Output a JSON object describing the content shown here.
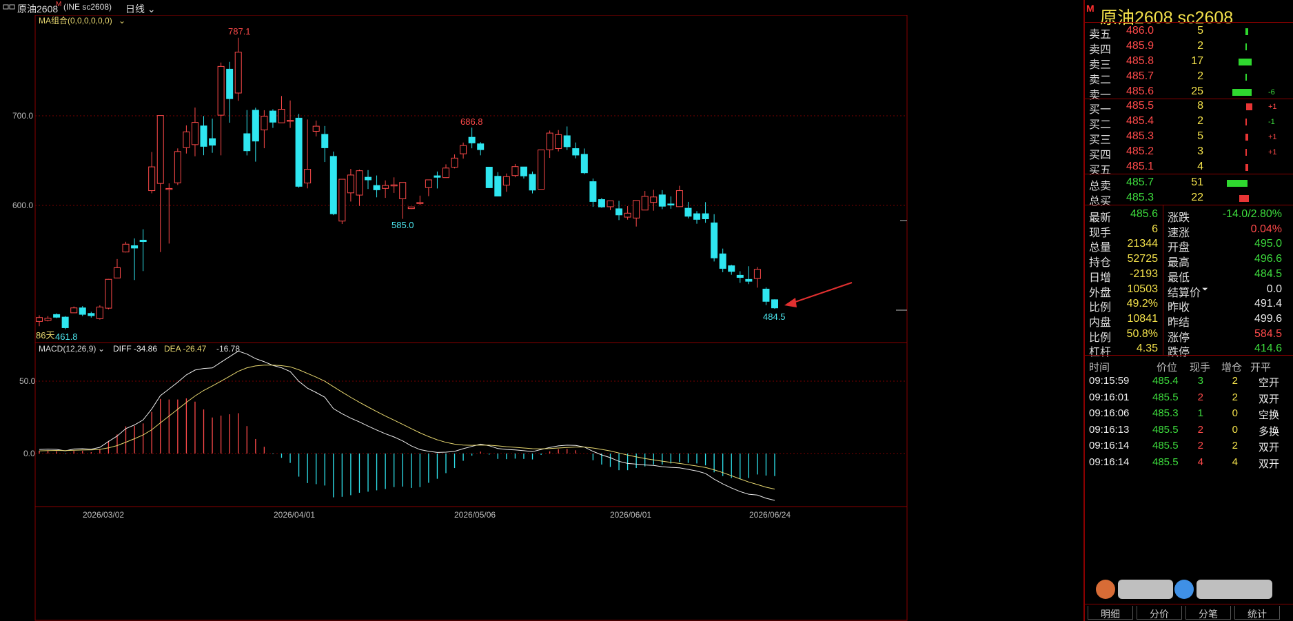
{
  "topbar": {
    "window_icon": "window-icon",
    "symbol_label": "原油2608",
    "symbol_marker": "M",
    "exchange_code": "(INE sc2608)",
    "period_label": "日线"
  },
  "ma_indicator": {
    "label": "MA组合(0,0,0,0,0,0)"
  },
  "macd_indicator": {
    "label": "MACD(12,26,9)",
    "diff": "DIFF -34.86",
    "dea": "DEA -26.47",
    "macd": "-16.78"
  },
  "colors": {
    "up": "#ff4a4a",
    "down": "#2fe6f0",
    "diff_line": "#eeeeee",
    "dea_line": "#e8d870",
    "border": "#8a0000",
    "arrow": "#e23030"
  },
  "annotations": {
    "high": "787.1",
    "peak2": "686.8",
    "low_mid": "585.0",
    "low_start": "461.8",
    "last_low": "484.5",
    "days": "86天"
  },
  "axis": {
    "price_ticks": [
      "700.0",
      "600.0"
    ],
    "macd_ticks": [
      "50.0",
      "0.0"
    ],
    "dates": [
      "2026/03/02",
      "2026/04/01",
      "2026/05/06",
      "2026/06/01",
      "2026/06/24"
    ]
  },
  "chart_data": {
    "type": "candlestick",
    "ylim": [
      450,
      800
    ],
    "candles": [
      [
        470.5,
        474.8,
        465.2,
        477.3
      ],
      [
        471.7,
        474.1,
        470.5,
        476.5
      ],
      [
        478.2,
        475.2,
        474.1,
        479.5
      ],
      [
        475.3,
        463.5,
        461.8,
        476.4
      ],
      [
        480.1,
        485.6,
        480.1,
        487.2
      ],
      [
        485.6,
        478.4,
        476.4,
        487.6
      ],
      [
        479.4,
        477.0,
        474.8,
        481.2
      ],
      [
        473.6,
        486.6,
        472.5,
        488.5
      ],
      [
        485.3,
        517.5,
        484.1,
        517.9
      ],
      [
        519.0,
        530.5,
        518.9,
        540.1
      ],
      [
        548.0,
        556.7,
        547.5,
        559.4
      ],
      [
        555.0,
        552.4,
        516.7,
        563.2
      ],
      [
        561.2,
        559.6,
        526.7,
        573.4
      ],
      [
        616.5,
        643.0,
        613.5,
        659.6
      ],
      [
        624.5,
        700.3,
        547.9,
        700.3
      ],
      [
        618.4,
        618.9,
        557.4,
        624.6
      ],
      [
        625.2,
        660.1,
        622.8,
        663.6
      ],
      [
        664.5,
        682.1,
        657.9,
        689.3
      ],
      [
        667.8,
        692.6,
        654.8,
        709.2
      ],
      [
        688.7,
        665.9,
        656.0,
        699.7
      ],
      [
        674.5,
        667.2,
        658.7,
        696.8
      ],
      [
        700.7,
        755.1,
        655.9,
        759.4
      ],
      [
        752.0,
        719.1,
        692.3,
        760.2
      ],
      [
        725.4,
        771.0,
        716.7,
        787.1
      ],
      [
        680.0,
        661.0,
        655.8,
        706.4
      ],
      [
        706.2,
        671.8,
        648.8,
        709.0
      ],
      [
        684.2,
        699.5,
        663.8,
        706.2
      ],
      [
        705.3,
        692.9,
        686.5,
        707.3
      ],
      [
        692.2,
        707.3,
        702.0,
        722.1
      ],
      [
        694.6,
        695.0,
        686.4,
        717.1
      ],
      [
        697.4,
        621.3,
        619.7,
        702.1
      ],
      [
        625.0,
        640.3,
        619.0,
        695.9
      ],
      [
        682.7,
        688.4,
        677.0,
        694.7
      ],
      [
        679.3,
        664.3,
        648.4,
        688.6
      ],
      [
        654.7,
        590.6,
        589.1,
        660.1
      ],
      [
        582.5,
        629.2,
        579.2,
        629.2
      ],
      [
        614.0,
        633.9,
        604.3,
        640.7
      ],
      [
        611.5,
        638.7,
        599.4,
        639.9
      ],
      [
        631.4,
        628.5,
        618.3,
        639.4
      ],
      [
        622.2,
        617.4,
        609.0,
        633.4
      ],
      [
        619.0,
        622.2,
        608.4,
        627.9
      ],
      [
        622.7,
        622.9,
        613.9,
        631.3
      ],
      [
        607.4,
        625.6,
        585.0,
        625.6
      ],
      [
        596.4,
        598.3,
        596.0,
        597.8
      ],
      [
        603.2,
        603.2,
        600.4,
        610.9
      ],
      [
        619.9,
        628.5,
        610.3,
        621.9
      ],
      [
        633.0,
        631.4,
        618.9,
        637.8
      ],
      [
        631.0,
        641.7,
        636.7,
        645.8
      ],
      [
        642.6,
        652.8,
        641.3,
        656.9
      ],
      [
        657.6,
        666.8,
        652.2,
        670.1
      ],
      [
        676.0,
        669.7,
        663.7,
        686.8
      ],
      [
        668.7,
        662.2,
        655.9,
        670.6
      ],
      [
        642.7,
        619.7,
        619.4,
        642.9
      ],
      [
        632.5,
        610.4,
        610.1,
        637.1
      ],
      [
        622.6,
        632.1,
        615.2,
        635.6
      ],
      [
        633.3,
        643.3,
        631.4,
        646.2
      ],
      [
        642.9,
        632.9,
        630.0,
        642.9
      ],
      [
        634.6,
        617.1,
        613.4,
        637.8
      ],
      [
        618.0,
        661.9,
        617.9,
        662.0
      ],
      [
        662.0,
        680.7,
        653.0,
        683.5
      ],
      [
        663.5,
        679.0,
        660.3,
        684.1
      ],
      [
        677.7,
        665.5,
        661.8,
        688.1
      ],
      [
        663.4,
        656.2,
        652.5,
        670.2
      ],
      [
        657.0,
        636.4,
        634.9,
        663.5
      ],
      [
        626.5,
        604.3,
        598.4,
        630.0
      ],
      [
        606.5,
        598.3,
        597.3,
        608.3
      ],
      [
        598.5,
        605.1,
        594.7,
        601.4
      ],
      [
        596.2,
        589.4,
        583.6,
        605.1
      ],
      [
        586.9,
        591.3,
        584.1,
        599.2
      ],
      [
        585.9,
        605.5,
        576.4,
        605.5
      ],
      [
        594.8,
        610.1,
        594.7,
        616.1
      ],
      [
        603.3,
        609.4,
        594.1,
        617.4
      ],
      [
        611.7,
        599.1,
        595.8,
        617.0
      ],
      [
        601.6,
        600.4,
        596.3,
        610.0
      ],
      [
        598.6,
        616.5,
        603.2,
        621.9
      ],
      [
        596.8,
        587.9,
        585.5,
        603.9
      ],
      [
        590.7,
        584.4,
        579.5,
        593.6
      ],
      [
        590.7,
        585.0,
        580.6,
        603.6
      ],
      [
        580.5,
        541.4,
        537.4,
        590.2
      ],
      [
        545.9,
        529.7,
        525.4,
        551.8
      ],
      [
        532.6,
        526.3,
        522.6,
        533.7
      ],
      [
        522.0,
        519.6,
        513.6,
        526.5
      ],
      [
        517.4,
        515.3,
        512.1,
        532.1
      ],
      [
        518.4,
        528.6,
        508.2,
        531.2
      ],
      [
        506.6,
        492.9,
        488.7,
        508.5
      ],
      [
        494.7,
        485.6,
        484.5,
        495.2
      ]
    ],
    "diff": [
      3.0,
      3.3,
      3.1,
      2.0,
      3.4,
      3.6,
      3.2,
      4.6,
      8.9,
      13.0,
      18.5,
      21.3,
      25.0,
      33.2,
      43.1,
      48.0,
      53.0,
      58.5,
      62.1,
      63.3,
      63.7,
      67.9,
      72.1,
      76.2,
      74.0,
      70.6,
      68.3,
      65.6,
      63.8,
      61.0,
      53.7,
      48.6,
      45.4,
      41.9,
      33.4,
      29.6,
      26.3,
      23.5,
      20.4,
      17.5,
      14.7,
      12.3,
      9.4,
      5.7,
      2.9,
      1.7,
      0.8,
      1.0,
      1.6,
      3.6,
      5.3,
      7.0,
      5.8,
      3.7,
      3.0,
      2.7,
      2.1,
      1.4,
      3.0,
      4.5,
      5.7,
      6.2,
      6.0,
      4.8,
      1.6,
      -1.0,
      -3.1,
      -5.8,
      -7.4,
      -7.9,
      -8.5,
      -8.8,
      -9.8,
      -10.3,
      -10.6,
      -11.8,
      -13.0,
      -14.8,
      -19.1,
      -22.6,
      -25.6,
      -28.3,
      -30.3,
      -30.9,
      -33.3,
      -34.86
    ],
    "dea": [
      2.0,
      2.2,
      2.3,
      2.2,
      2.4,
      2.6,
      2.7,
      3.1,
      4.2,
      5.9,
      8.4,
      11.0,
      13.8,
      17.7,
      22.8,
      27.9,
      32.9,
      38.0,
      42.8,
      46.9,
      50.3,
      53.8,
      57.5,
      61.2,
      63.8,
      65.2,
      65.8,
      65.8,
      65.4,
      64.5,
      62.3,
      59.6,
      56.8,
      53.8,
      49.7,
      45.7,
      41.8,
      38.1,
      34.6,
      31.2,
      27.9,
      24.8,
      21.7,
      18.5,
      15.4,
      12.6,
      10.2,
      8.3,
      7.0,
      6.3,
      6.1,
      6.3,
      6.2,
      5.7,
      5.1,
      4.6,
      4.1,
      3.6,
      3.5,
      3.7,
      4.1,
      4.5,
      4.8,
      4.8,
      4.1,
      3.1,
      1.9,
      0.4,
      -1.2,
      -2.5,
      -3.7,
      -4.7,
      -5.7,
      -6.6,
      -7.4,
      -8.3,
      -9.3,
      -10.4,
      -12.1,
      -14.2,
      -16.5,
      -18.9,
      -21.2,
      -23.1,
      -25.1,
      -26.47
    ],
    "ylabel_macd": "MACD"
  },
  "orderbook": {
    "title": "原油2608  sc2608",
    "marker": "M",
    "asks": [
      {
        "label": "卖五",
        "price": "486.0",
        "qty": "5",
        "bar": 0.2,
        "delta": ""
      },
      {
        "label": "卖四",
        "price": "485.9",
        "qty": "2",
        "bar": 0.08,
        "delta": ""
      },
      {
        "label": "卖三",
        "price": "485.8",
        "qty": "17",
        "bar": 0.62,
        "delta": ""
      },
      {
        "label": "卖二",
        "price": "485.7",
        "qty": "2",
        "bar": 0.08,
        "delta": ""
      },
      {
        "label": "卖一",
        "price": "485.6",
        "qty": "25",
        "bar": 0.92,
        "delta": "-6"
      }
    ],
    "bids": [
      {
        "label": "买一",
        "price": "485.5",
        "qty": "8",
        "bar": 0.3,
        "delta": "+1"
      },
      {
        "label": "买二",
        "price": "485.4",
        "qty": "2",
        "bar": 0.08,
        "delta": "-1"
      },
      {
        "label": "买三",
        "price": "485.3",
        "qty": "5",
        "bar": 0.2,
        "delta": "+1"
      },
      {
        "label": "买四",
        "price": "485.2",
        "qty": "3",
        "bar": 0.12,
        "delta": "+1"
      },
      {
        "label": "买五",
        "price": "485.1",
        "qty": "4",
        "bar": 0.15,
        "delta": ""
      }
    ],
    "total_sell": {
      "label": "总卖",
      "price": "485.7",
      "qty": "51",
      "bar": 1.0
    },
    "total_buy": {
      "label": "总买",
      "price": "485.3",
      "qty": "22",
      "bar": 0.45
    }
  },
  "stats": [
    {
      "l1": "最新",
      "v1": "485.6",
      "c1": "green",
      "l2": "涨跌",
      "v2": "-14.0/2.80%",
      "c2": "green"
    },
    {
      "l1": "现手",
      "v1": "6",
      "c1": "yellow",
      "l2": "速涨",
      "v2": "0.04%",
      "c2": "red"
    },
    {
      "l1": "总量",
      "v1": "21344",
      "c1": "yellow",
      "l2": "开盘",
      "v2": "495.0",
      "c2": "green"
    },
    {
      "l1": "持仓",
      "v1": "52725",
      "c1": "yellow",
      "l2": "最高",
      "v2": "496.6",
      "c2": "green"
    },
    {
      "l1": "日增",
      "v1": "-2193",
      "c1": "yellow",
      "l2": "最低",
      "v2": "484.5",
      "c2": "green"
    },
    {
      "l1": "外盘",
      "v1": "10503",
      "c1": "yellow",
      "l2": "结算价",
      "v2": "0.0",
      "c2": "white"
    },
    {
      "l1": "比例",
      "v1": "49.2%",
      "c1": "yellow",
      "l2": "昨收",
      "v2": "491.4",
      "c2": "white"
    },
    {
      "l1": "内盘",
      "v1": "10841",
      "c1": "yellow",
      "l2": "昨结",
      "v2": "499.6",
      "c2": "white"
    },
    {
      "l1": "比例",
      "v1": "50.8%",
      "c1": "yellow",
      "l2": "涨停",
      "v2": "584.5",
      "c2": "red"
    },
    {
      "l1": "杠杆",
      "v1": "4.35",
      "c1": "yellow",
      "l2": "跌停",
      "v2": "414.6",
      "c2": "green"
    }
  ],
  "ticks": {
    "headers": [
      "时间",
      "价位",
      "现手",
      "增仓",
      "开平"
    ],
    "rows": [
      {
        "time": "09:15:59",
        "price": "485.4",
        "qty": "3",
        "qc": "green",
        "add": "2",
        "type": "空开"
      },
      {
        "time": "09:16:01",
        "price": "485.5",
        "qty": "2",
        "qc": "red",
        "add": "2",
        "type": "双开"
      },
      {
        "time": "09:16:06",
        "price": "485.3",
        "qty": "1",
        "qc": "green",
        "add": "0",
        "type": "空换"
      },
      {
        "time": "09:16:13",
        "price": "485.5",
        "qty": "2",
        "qc": "red",
        "add": "0",
        "type": "多换"
      },
      {
        "time": "09:16:14",
        "price": "485.5",
        "qty": "2",
        "qc": "red",
        "add": "2",
        "type": "双开"
      },
      {
        "time": "09:16:14",
        "price": "485.5",
        "qty": "4",
        "qc": "red",
        "add": "4",
        "type": "双开"
      }
    ]
  },
  "tabs": [
    "明细",
    "分价",
    "分笔",
    "统计"
  ]
}
